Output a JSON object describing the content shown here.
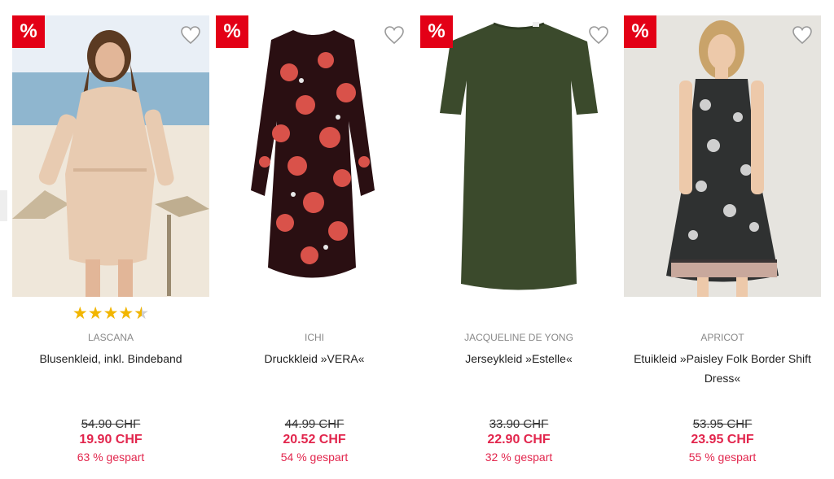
{
  "badge_label": "%",
  "colors": {
    "sale_badge": "#e30016",
    "price_red": "#e2264d",
    "star": "#f2b600"
  },
  "products": [
    {
      "brand": "LASCANA",
      "name": "Blusenkleid, inkl. Bindeband",
      "old_price": "54.90 CHF",
      "new_price": "19.90 CHF",
      "saved": "63 % gespart",
      "rating": 4.5
    },
    {
      "brand": "ICHI",
      "name": "Druckkleid »VERA«",
      "old_price": "44.99 CHF",
      "new_price": "20.52 CHF",
      "saved": "54 % gespart"
    },
    {
      "brand": "JACQUELINE DE YONG",
      "name": "Jerseykleid »Estelle«",
      "old_price": "33.90 CHF",
      "new_price": "22.90 CHF",
      "saved": "32 % gespart"
    },
    {
      "brand": "APRICOT",
      "name": "Etuikleid »Paisley Folk Border Shift Dress«",
      "old_price": "53.95 CHF",
      "new_price": "23.95 CHF",
      "saved": "55 % gespart"
    }
  ]
}
